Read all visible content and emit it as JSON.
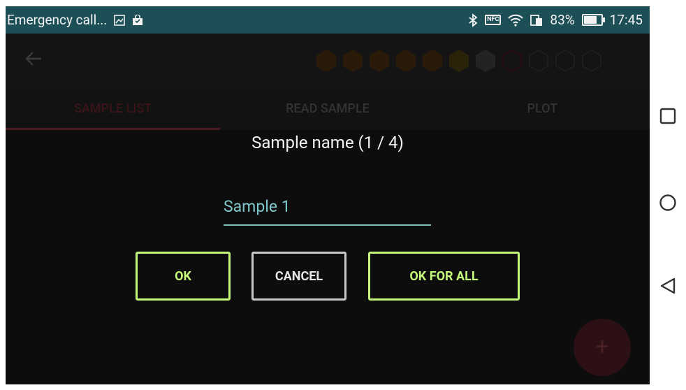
{
  "status_bar": {
    "notification_title": "Emergency call...",
    "battery_percent": "83%",
    "time": "17:45",
    "battery_level": 0.83,
    "nfc_label": "NFC"
  },
  "app": {
    "tabs": [
      {
        "label": "SAMPLE LIST",
        "active": true
      },
      {
        "label": "READ SAMPLE",
        "active": false
      },
      {
        "label": "PLOT",
        "active": false
      }
    ],
    "hex_indicators": [
      {
        "state": "filled",
        "color": "#2a1a0a"
      },
      {
        "state": "filled",
        "color": "#2a1a0a"
      },
      {
        "state": "filled",
        "color": "#2a1a0a"
      },
      {
        "state": "filled",
        "color": "#2a1a0a"
      },
      {
        "state": "filled",
        "color": "#2a1a0a"
      },
      {
        "state": "filled",
        "color": "#2a230a"
      },
      {
        "state": "filled",
        "color": "#232323"
      },
      {
        "state": "outline",
        "color": "#2a0d10"
      },
      {
        "state": "outline",
        "color": "#1e1e1e"
      },
      {
        "state": "outline",
        "color": "#1e1e1e"
      },
      {
        "state": "outline",
        "color": "#1e1e1e"
      }
    ],
    "fab_label": "+"
  },
  "dialog": {
    "title": "Sample name (1 / 4)",
    "input_value": "Sample 1",
    "buttons": {
      "ok": "OK",
      "cancel": "CANCEL",
      "ok_for_all": "OK FOR ALL"
    }
  },
  "icons": {
    "back": "arrow-left-icon",
    "gallery": "image-icon",
    "bag": "shopping-bag-icon",
    "bluetooth": "bluetooth-icon",
    "wifi": "wifi-icon",
    "sim": "sim-icon",
    "battery": "battery-icon",
    "recents": "square-icon",
    "home": "circle-icon",
    "back_nav": "triangle-back-icon"
  },
  "colors": {
    "status_bar": "#1d4f57",
    "accent_button": "#c5f97a",
    "input_text": "#80c8cb"
  }
}
